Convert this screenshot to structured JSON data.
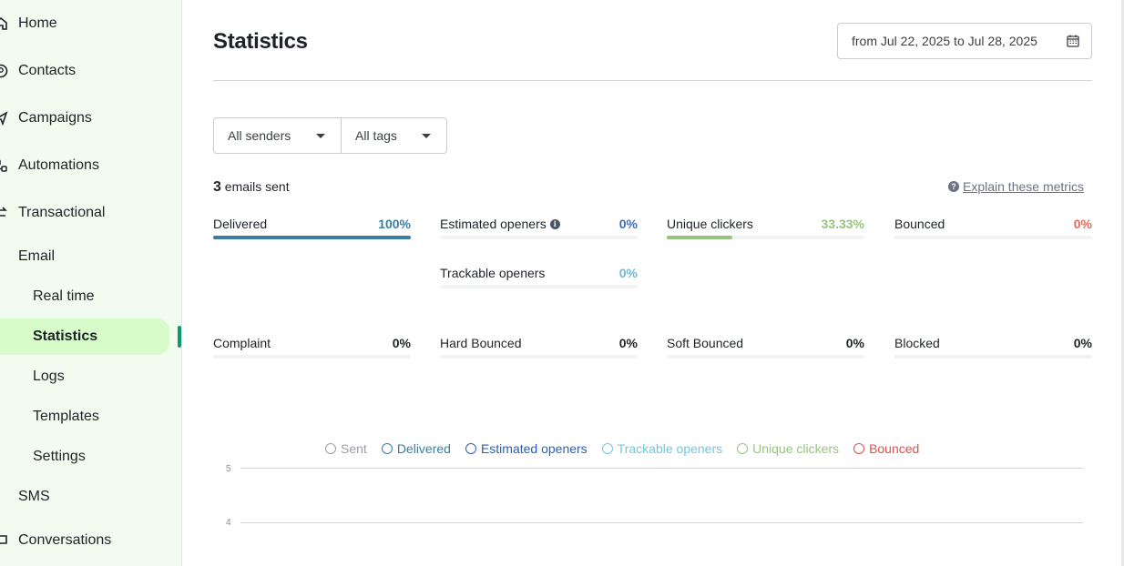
{
  "sidebar": {
    "items": [
      {
        "label": "Home",
        "icon": "home-icon"
      },
      {
        "label": "Contacts",
        "icon": "contacts-icon"
      },
      {
        "label": "Campaigns",
        "icon": "campaigns-icon"
      },
      {
        "label": "Automations",
        "icon": "automations-icon"
      },
      {
        "label": "Transactional",
        "icon": "transactional-icon"
      },
      {
        "label": "Email"
      },
      {
        "label": "Real time"
      },
      {
        "label": "Statistics"
      },
      {
        "label": "Logs"
      },
      {
        "label": "Templates"
      },
      {
        "label": "Settings"
      },
      {
        "label": "SMS"
      },
      {
        "label": "Conversations",
        "icon": "conversations-icon"
      }
    ],
    "active": "Statistics",
    "active_color": "#d7fbc9",
    "marker_color": "#0b996e"
  },
  "header": {
    "title": "Statistics",
    "date_range": "from Jul 22, 2025 to Jul 28, 2025"
  },
  "filters": {
    "senders": "All senders",
    "tags": "All tags"
  },
  "summary": {
    "count": "3",
    "count_suffix": "emails sent",
    "explain_link": "Explain these metrics"
  },
  "metrics": {
    "delivered": {
      "label": "Delivered",
      "value": "100%",
      "fill": 1.0,
      "color": "#3b7ea1"
    },
    "estimated_openers": {
      "label": "Estimated openers",
      "value": "0%",
      "fill": 0,
      "color": "#3c6fb6"
    },
    "trackable_openers": {
      "label": "Trackable openers",
      "value": "0%",
      "fill": 0,
      "color": "#72b7d8"
    },
    "unique_clickers": {
      "label": "Unique clickers",
      "value": "33.33%",
      "fill": 0.3333,
      "color": "#96c47e"
    },
    "bounced": {
      "label": "Bounced",
      "value": "0%",
      "fill": 0,
      "color": "#e06b5f"
    },
    "complaint": {
      "label": "Complaint",
      "value": "0%",
      "fill": 0
    },
    "hard_bounced": {
      "label": "Hard Bounced",
      "value": "0%",
      "fill": 0
    },
    "soft_bounced": {
      "label": "Soft Bounced",
      "value": "0%",
      "fill": 0
    },
    "blocked": {
      "label": "Blocked",
      "value": "0%",
      "fill": 0
    }
  },
  "chart": {
    "legend": [
      {
        "label": "Sent",
        "color": "#9aa0a6"
      },
      {
        "label": "Delivered",
        "color": "#3b7ea1"
      },
      {
        "label": "Estimated openers",
        "color": "#2b5fb3"
      },
      {
        "label": "Trackable openers",
        "color": "#72c7de"
      },
      {
        "label": "Unique clickers",
        "color": "#96c47e"
      },
      {
        "label": "Bounced",
        "color": "#e0504a"
      }
    ],
    "y_ticks": [
      "5",
      "4"
    ]
  }
}
